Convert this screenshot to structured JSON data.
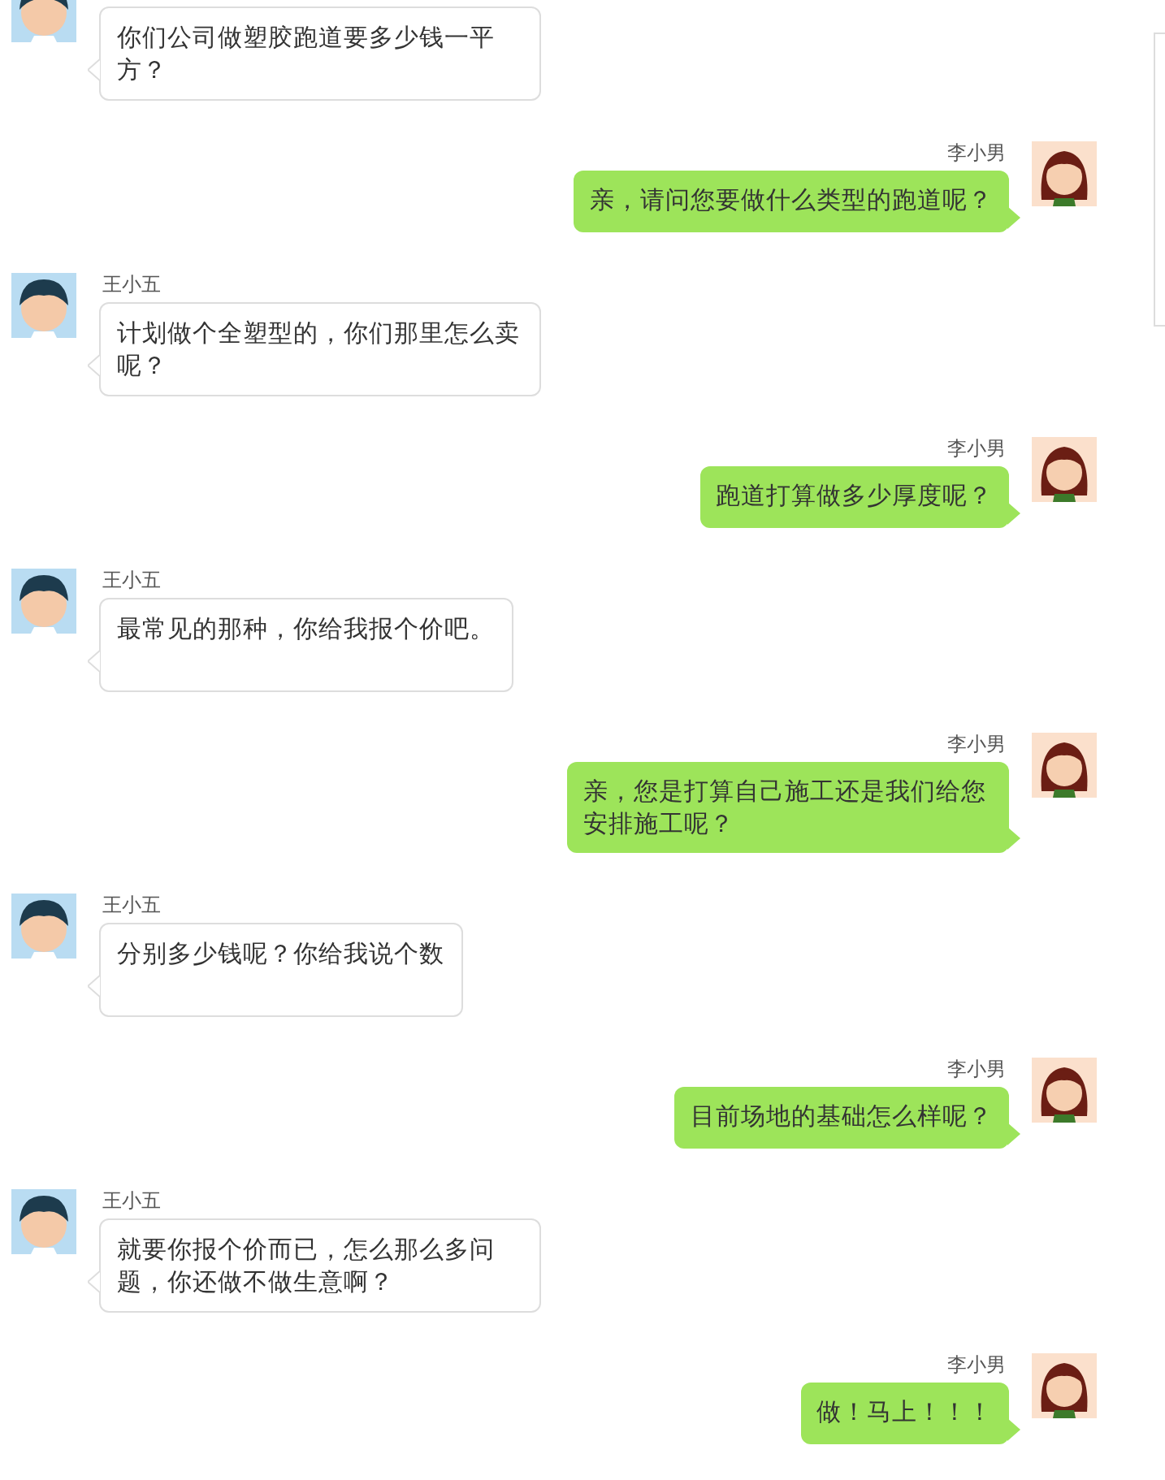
{
  "messages": [
    {
      "kind": "incoming",
      "text": "你们公司做塑胶跑道要多少钱一平方？"
    },
    {
      "kind": "outgoing",
      "sender": "李小男",
      "text": "亲，请问您要做什么类型的跑道呢？"
    },
    {
      "kind": "incoming",
      "sender": "王小五",
      "text": "计划做个全塑型的，你们那里怎么卖呢？"
    },
    {
      "kind": "outgoing",
      "sender": "李小男",
      "text": "跑道打算做多少厚度呢？"
    },
    {
      "kind": "incoming",
      "sender": "王小五",
      "text": "最常见的那种，你给我报个价吧。"
    },
    {
      "kind": "outgoing",
      "sender": "李小男",
      "text": "亲，您是打算自己施工还是我们给您安排施工呢？"
    },
    {
      "kind": "incoming",
      "sender": "王小五",
      "text": "分别多少钱呢？你给我说个数"
    },
    {
      "kind": "outgoing",
      "sender": "李小男",
      "text": "目前场地的基础怎么样呢？"
    },
    {
      "kind": "incoming",
      "sender": "王小五",
      "text": "就要你报个价而已，怎么那么多问题，你还做不做生意啊？"
    },
    {
      "kind": "outgoing",
      "sender": "李小男",
      "text": "做！马上！！！"
    }
  ]
}
